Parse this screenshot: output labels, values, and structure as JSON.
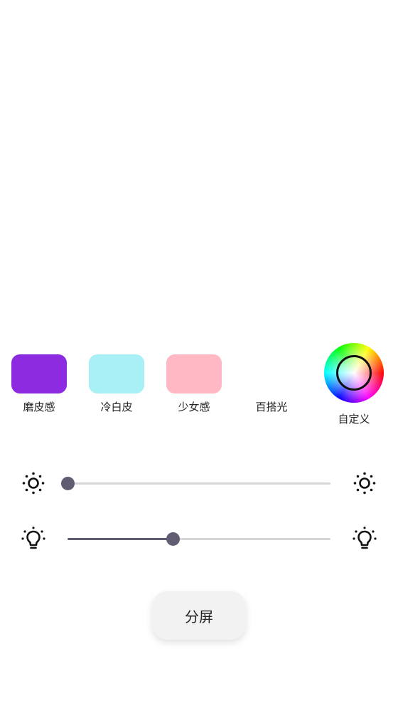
{
  "presets": [
    {
      "label": "磨皮感",
      "color": "#8c2be0"
    },
    {
      "label": "冷白皮",
      "color": "#a8f0f6"
    },
    {
      "label": "少女感",
      "color": "#ffb8c4"
    },
    {
      "label": "百搭光",
      "color": ""
    }
  ],
  "custom": {
    "label": "自定义",
    "icon": "color-wheel-icon"
  },
  "sliders": [
    {
      "name": "brightness",
      "value_fraction": 0.0,
      "left_icon": "sun-icon",
      "right_icon": "sun-icon"
    },
    {
      "name": "light-intensity",
      "value_fraction": 0.4,
      "left_icon": "lightbulb-icon",
      "right_icon": "lightbulb-icon"
    }
  ],
  "split_button": {
    "label": "分屏"
  },
  "colors": {
    "accent": "#625c73",
    "track": "#d6d6d8"
  }
}
